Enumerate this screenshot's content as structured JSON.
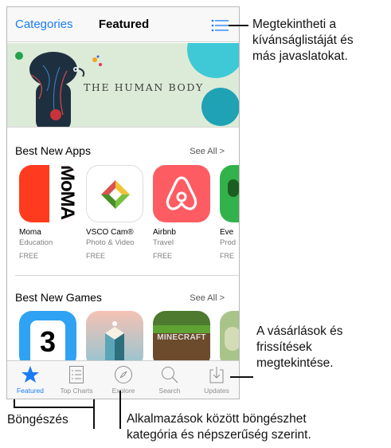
{
  "navbar": {
    "left_label": "Categories",
    "title": "Featured",
    "list_icon": "list-icon"
  },
  "banner": {
    "title": "THE HUMAN BODY"
  },
  "sections": [
    {
      "title": "Best New Apps",
      "see_all": "See All >",
      "apps": [
        {
          "name": "Moma",
          "category": "Education",
          "price": "FREE",
          "icon": "moma-icon"
        },
        {
          "name": "VSCO Cam®",
          "category": "Photo & Video",
          "price": "FREE",
          "icon": "vsco-icon"
        },
        {
          "name": "Airbnb",
          "category": "Travel",
          "price": "FREE",
          "icon": "airbnb-icon"
        },
        {
          "name": "Eve",
          "category": "Prod",
          "price": "FRE",
          "icon": "eve-icon"
        }
      ]
    },
    {
      "title": "Best New Games",
      "see_all": "See All >",
      "games": [
        {
          "icon": "three-game-icon",
          "icon_text": "3"
        },
        {
          "icon": "monument-valley-icon"
        },
        {
          "icon": "minecraft-icon",
          "icon_text": "MINECRAFT"
        },
        {
          "icon": "forest-game-icon"
        }
      ]
    }
  ],
  "tabbar": {
    "tabs": [
      {
        "label": "Featured",
        "icon": "star-icon",
        "active": true
      },
      {
        "label": "Top Charts",
        "icon": "top-charts-icon"
      },
      {
        "label": "Explore",
        "icon": "compass-icon"
      },
      {
        "label": "Search",
        "icon": "search-icon"
      },
      {
        "label": "Updates",
        "icon": "updates-icon"
      }
    ]
  },
  "callouts": {
    "wishlist": [
      "Megtekintheti a",
      "kívánságlistáját és",
      "más javaslatokat."
    ],
    "purchases": [
      "A vásárlások és",
      "frissítések",
      "megtekintése."
    ],
    "browse": "Böngészés",
    "categories": [
      "Alkalmazások között böngészhet",
      "kategória és népszerűség szerint."
    ]
  },
  "colors": {
    "accent": "#1a7cf4",
    "moma_red": "#ff3b1f",
    "airbnb": "#fd5c63",
    "banner_bg": "#dcebd8"
  }
}
